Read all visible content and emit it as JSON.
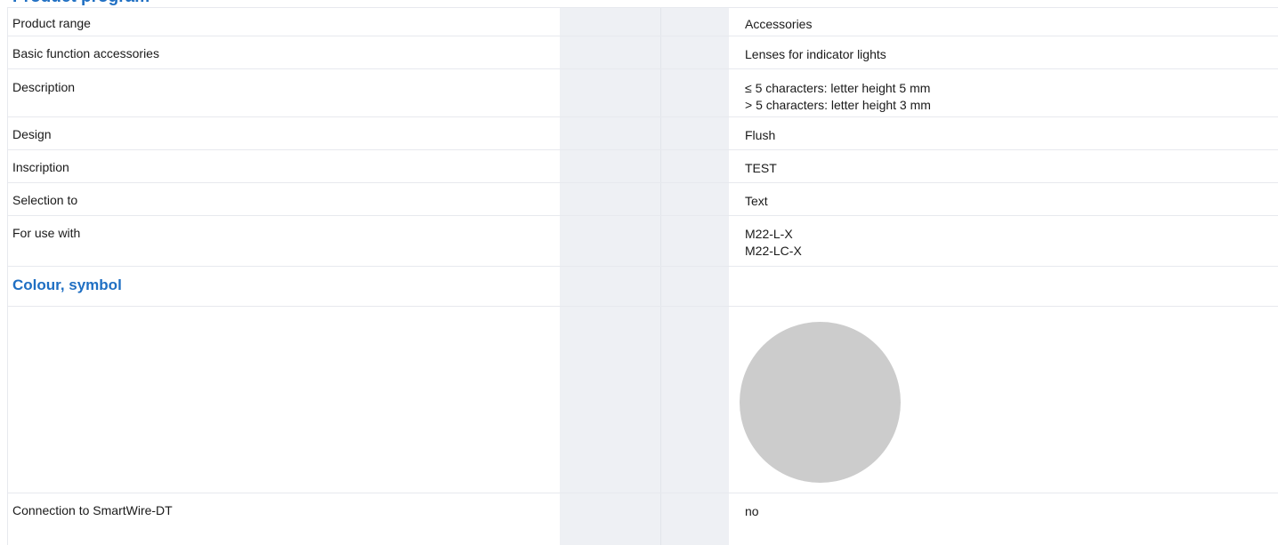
{
  "heading": "Product program",
  "rows": [
    {
      "label": "Product range",
      "value": [
        "Accessories"
      ]
    },
    {
      "label": "Basic function accessories",
      "value": [
        "Lenses for indicator lights"
      ]
    },
    {
      "label": "Description",
      "value": [
        "≤ 5 characters: letter height 5 mm",
        "> 5 characters: letter height 3 mm"
      ]
    },
    {
      "label": "Design",
      "value": [
        "Flush"
      ]
    },
    {
      "label": "Inscription",
      "value": [
        "TEST"
      ]
    },
    {
      "label": "Selection to",
      "value": [
        "Text"
      ]
    },
    {
      "label": "For use with",
      "value": [
        "M22-L-X",
        "M22-LC-X"
      ]
    }
  ],
  "section": {
    "title": "Colour, symbol",
    "swatch_color": "#cccccc"
  },
  "last_row": {
    "label": "Connection to SmartWire-DT",
    "value": "no"
  },
  "colors": {
    "accent": "#1f6fc3",
    "column_shade": "#eef0f4",
    "row_border": "#e7e9ee"
  }
}
